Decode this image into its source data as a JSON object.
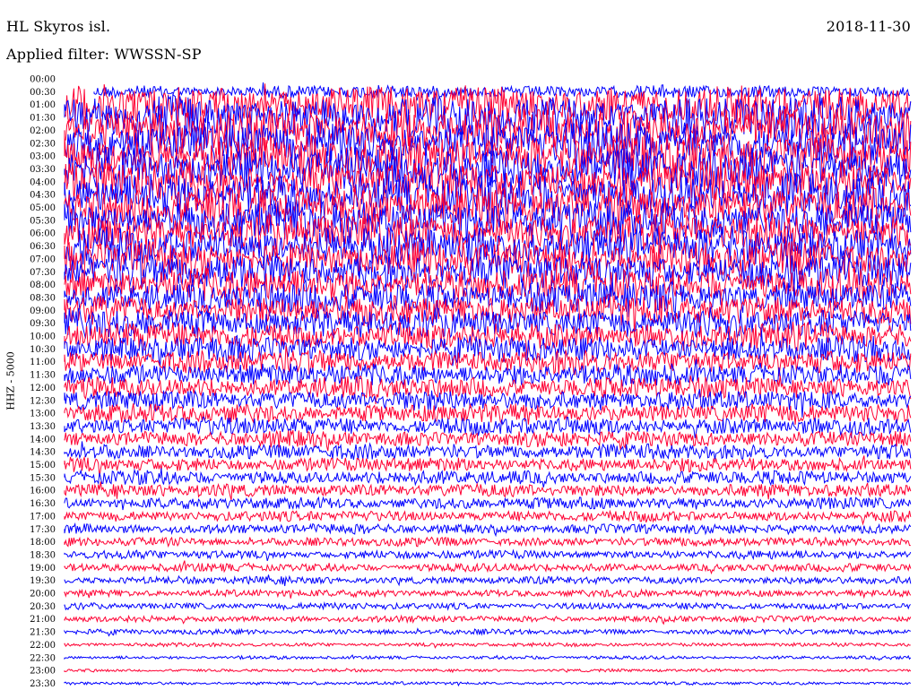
{
  "header": {
    "station": "HL Skyros isl.",
    "date": "2018-11-30",
    "filter": "Applied filter: WWSSN-SP",
    "ylabel": "HHZ - 5000"
  },
  "colors": {
    "trace_a": "#0000ff",
    "trace_b": "#ff0033",
    "background": "#ffffff"
  },
  "chart_data": {
    "type": "line",
    "title": "HL Skyros isl.",
    "subtitle": "Applied filter: WWSSN-SP",
    "ylabel": "HHZ - 5000",
    "xlabel": "",
    "rows": [
      "00:00",
      "00:30",
      "01:00",
      "01:30",
      "02:00",
      "02:30",
      "03:00",
      "03:30",
      "04:00",
      "04:30",
      "05:00",
      "05:30",
      "06:00",
      "06:30",
      "07:00",
      "07:30",
      "08:00",
      "08:30",
      "09:00",
      "09:30",
      "10:00",
      "10:30",
      "11:00",
      "11:30",
      "12:00",
      "12:30",
      "13:00",
      "13:30",
      "14:00",
      "14:30",
      "15:00",
      "15:30",
      "16:00",
      "16:30",
      "17:00",
      "17:30",
      "18:00",
      "18:30",
      "19:00",
      "19:30",
      "20:00",
      "20:30",
      "21:00",
      "21:30",
      "22:00",
      "22:30",
      "23:00",
      "23:30"
    ],
    "relative_amplitude": [
      0,
      0.55,
      1.6,
      1.8,
      1.8,
      1.8,
      1.8,
      1.8,
      1.75,
      1.75,
      1.7,
      1.7,
      1.6,
      1.6,
      1.5,
      1.5,
      1.4,
      1.35,
      1.3,
      1.25,
      1.15,
      1.1,
      1.0,
      0.95,
      0.9,
      0.85,
      0.8,
      0.75,
      0.7,
      0.65,
      0.6,
      0.58,
      0.55,
      0.5,
      0.45,
      0.42,
      0.38,
      0.36,
      0.34,
      0.32,
      0.3,
      0.28,
      0.26,
      0.22,
      0.16,
      0.14,
      0.12,
      0.13
    ],
    "trace_colors": [
      "blue",
      "red"
    ],
    "grid": false
  }
}
